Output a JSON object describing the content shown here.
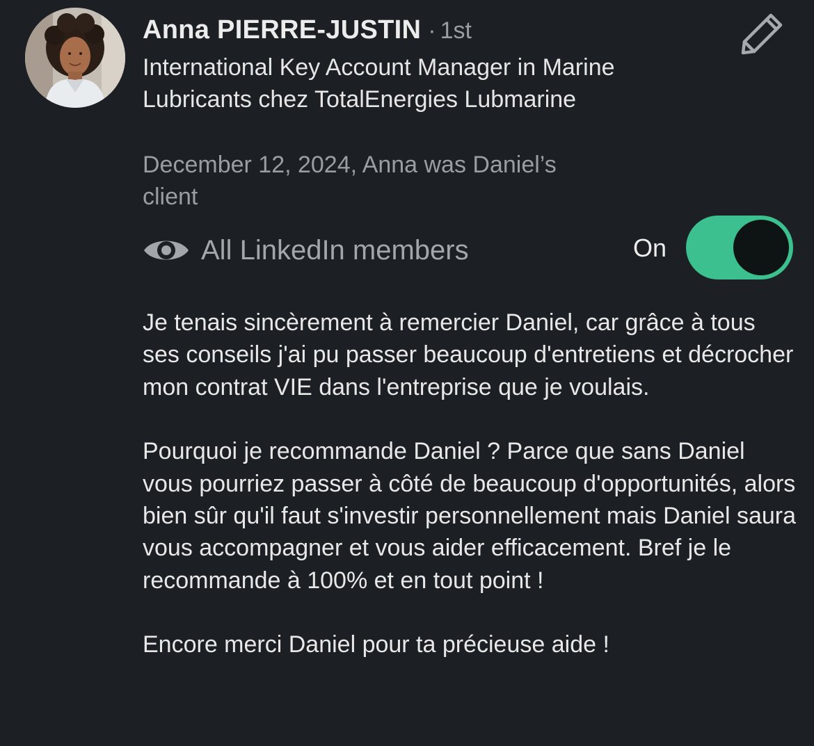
{
  "recommender": {
    "name": "Anna PIERRE-JUSTIN",
    "degree_separator": "·",
    "degree": "1st",
    "headline": "International Key Account Manager in Marine Lubricants chez TotalEnergies Lubmarine",
    "relationship": "December 12, 2024, Anna was Daniel’s client"
  },
  "visibility": {
    "icon": "eye-icon",
    "label": "All LinkedIn members",
    "toggle_state": "On",
    "toggle_on": true,
    "accent_color": "#3cc08f"
  },
  "edit": {
    "icon": "pencil-icon"
  },
  "recommendation": {
    "paragraphs": [
      "Je tenais sincèrement à remercier Daniel, car grâce à tous ses conseils j'ai pu passer beaucoup d'entretiens et décrocher mon contrat VIE dans l'entreprise que je voulais.",
      "Pourquoi je recommande Daniel ? Parce que sans Daniel vous pourriez passer à côté de beaucoup d'opportunités, alors bien sûr qu'il faut s'investir personnellement mais Daniel saura vous accompagner et vous aider efficacement. Bref je le recommande à 100% et en tout point !",
      "Encore merci Daniel pour ta précieuse aide !"
    ]
  },
  "colors": {
    "background": "#1c1f23",
    "primary_text": "#e8e8e8",
    "secondary_text": "#9a9ea3"
  }
}
